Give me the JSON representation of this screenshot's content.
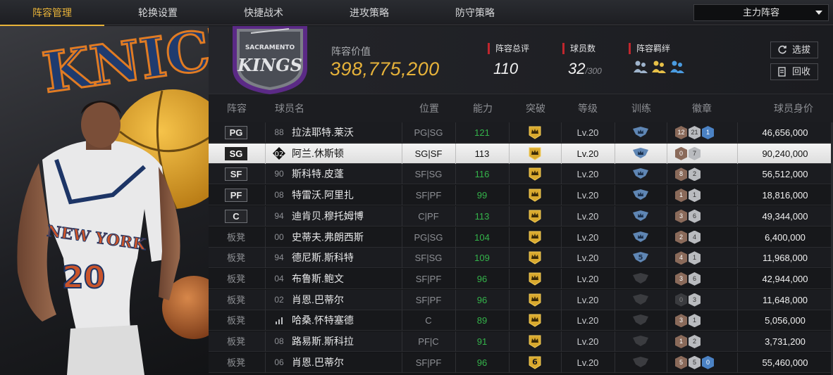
{
  "tabs": [
    {
      "label": "阵容管理",
      "active": true
    },
    {
      "label": "轮换设置",
      "active": false
    },
    {
      "label": "快捷战术",
      "active": false
    },
    {
      "label": "进攻策略",
      "active": false
    },
    {
      "label": "防守策略",
      "active": false
    }
  ],
  "lineup_dropdown": {
    "value": "主力阵容"
  },
  "summary": {
    "team_logo_text": "SACRAMENTO KINGS",
    "value_label": "阵容价值",
    "value": "398,775,200",
    "rating_label": "阵容总评",
    "rating": "110",
    "players_label": "球员数",
    "players": "32",
    "players_max": "/300",
    "bond_label": "阵容羁绊"
  },
  "buttons": {
    "select": "选拔",
    "recycle": "回收"
  },
  "columns": [
    "阵容",
    "球员名",
    "位置",
    "能力",
    "突破",
    "等级",
    "训练",
    "徽章",
    "球员身价"
  ],
  "rows": [
    {
      "slot": "PG",
      "starter": true,
      "jersey": "88",
      "name": "拉法耶特.莱沃",
      "pos": "PG|SG",
      "ability": "121",
      "breakthrough": "crown",
      "level": "Lv.20",
      "training": "crown",
      "badges": [
        {
          "v": "12",
          "t": "bronze"
        },
        {
          "v": "21",
          "t": "silver"
        },
        {
          "v": "1",
          "t": "blue"
        }
      ],
      "price": "46,656,000"
    },
    {
      "slot": "SG",
      "starter": true,
      "selected": true,
      "jersey": "02",
      "name": "阿兰.休斯顿",
      "pos": "SG|SF",
      "ability": "113",
      "breakthrough": "crown",
      "level": "Lv.20",
      "training": "crown",
      "badges": [
        {
          "v": "0",
          "t": "bronze"
        },
        {
          "v": "7",
          "t": "silver"
        }
      ],
      "price": "90,240,000"
    },
    {
      "slot": "SF",
      "starter": true,
      "jersey": "90",
      "name": "斯科特.皮蓬",
      "pos": "SF|SG",
      "ability": "116",
      "breakthrough": "crown",
      "level": "Lv.20",
      "training": "crown",
      "badges": [
        {
          "v": "8",
          "t": "bronze"
        },
        {
          "v": "2",
          "t": "silver"
        }
      ],
      "price": "56,512,000"
    },
    {
      "slot": "PF",
      "starter": true,
      "jersey": "08",
      "name": "特雷沃.阿里扎",
      "pos": "SF|PF",
      "ability": "99",
      "breakthrough": "crown",
      "level": "Lv.20",
      "training": "crown",
      "badges": [
        {
          "v": "1",
          "t": "bronze"
        },
        {
          "v": "1",
          "t": "silver"
        }
      ],
      "price": "18,816,000"
    },
    {
      "slot": "C",
      "starter": true,
      "jersey": "94",
      "name": "迪肯贝.穆托姆博",
      "pos": "C|PF",
      "ability": "113",
      "breakthrough": "crown",
      "level": "Lv.20",
      "training": "crown",
      "badges": [
        {
          "v": "3",
          "t": "bronze"
        },
        {
          "v": "6",
          "t": "silver"
        }
      ],
      "price": "49,344,000"
    },
    {
      "slot": "板凳",
      "starter": false,
      "jersey": "00",
      "name": "史蒂夫.弗朗西斯",
      "pos": "PG|SG",
      "ability": "104",
      "breakthrough": "crown",
      "level": "Lv.20",
      "training": "crown",
      "badges": [
        {
          "v": "2",
          "t": "bronze"
        },
        {
          "v": "4",
          "t": "silver"
        }
      ],
      "price": "6,400,000"
    },
    {
      "slot": "板凳",
      "starter": false,
      "jersey": "94",
      "name": "德尼斯.斯科特",
      "pos": "SF|SG",
      "ability": "109",
      "breakthrough": "crown",
      "level": "Lv.20",
      "training": "5",
      "badges": [
        {
          "v": "4",
          "t": "bronze"
        },
        {
          "v": "1",
          "t": "silver"
        }
      ],
      "price": "11,968,000"
    },
    {
      "slot": "板凳",
      "starter": false,
      "jersey": "04",
      "name": "布鲁斯.鲍文",
      "pos": "SF|PF",
      "ability": "96",
      "breakthrough": "crown",
      "level": "Lv.20",
      "training": "none",
      "badges": [
        {
          "v": "3",
          "t": "bronze"
        },
        {
          "v": "6",
          "t": "silver"
        }
      ],
      "price": "42,944,000"
    },
    {
      "slot": "板凳",
      "starter": false,
      "jersey": "02",
      "name": "肖恩.巴蒂尔",
      "pos": "SF|PF",
      "ability": "96",
      "breakthrough": "crown",
      "level": "Lv.20",
      "training": "none",
      "badges": [
        {
          "v": "0",
          "t": "dark"
        },
        {
          "v": "3",
          "t": "silver"
        }
      ],
      "price": "11,648,000"
    },
    {
      "slot": "板凳",
      "starter": false,
      "jersey": "",
      "name": "哈桑.怀特塞德",
      "pos": "C",
      "ability": "89",
      "breakthrough": "crown",
      "level": "Lv.20",
      "training": "none",
      "badges": [
        {
          "v": "3",
          "t": "bronze"
        },
        {
          "v": "1",
          "t": "silver"
        }
      ],
      "price": "5,056,000"
    },
    {
      "slot": "板凳",
      "starter": false,
      "jersey": "08",
      "name": "路易斯.斯科拉",
      "pos": "PF|C",
      "ability": "91",
      "breakthrough": "crown",
      "level": "Lv.20",
      "training": "none",
      "badges": [
        {
          "v": "1",
          "t": "bronze"
        },
        {
          "v": "2",
          "t": "silver"
        }
      ],
      "price": "3,731,200"
    },
    {
      "slot": "板凳",
      "starter": false,
      "jersey": "06",
      "name": "肖恩.巴蒂尔",
      "pos": "SF|PF",
      "ability": "96",
      "breakthrough": "6",
      "level": "Lv.20",
      "training": "none",
      "badges": [
        {
          "v": "5",
          "t": "bronze"
        },
        {
          "v": "5",
          "t": "silver"
        },
        {
          "v": "0",
          "t": "blue"
        }
      ],
      "price": "55,460,000"
    }
  ],
  "colors": {
    "accent": "#e8b339",
    "ability_green": "#34b34a",
    "stat_marker": "#c0262d"
  }
}
